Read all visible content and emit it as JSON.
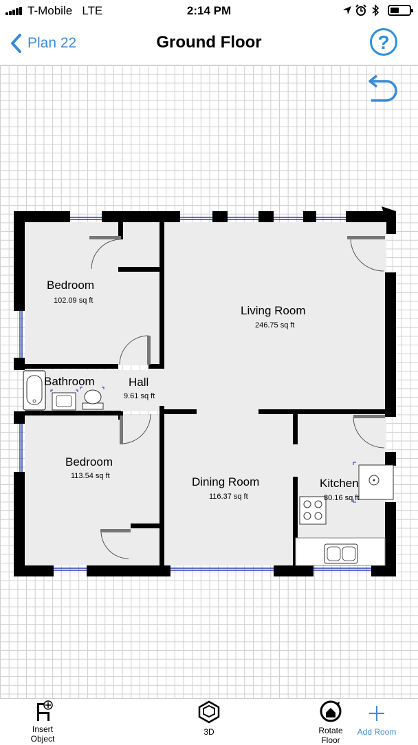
{
  "status_bar": {
    "carrier": "T-Mobile",
    "network": "LTE",
    "time": "2:14 PM"
  },
  "nav": {
    "back_label": "Plan 22",
    "title": "Ground Floor",
    "help_label": "?"
  },
  "rooms": [
    {
      "name": "Bedroom",
      "area": "102.09 sq ft"
    },
    {
      "name": "Living Room",
      "area": "246.75 sq ft"
    },
    {
      "name": "Bathroom",
      "area": ""
    },
    {
      "name": "Hall",
      "area": "9.61 sq ft"
    },
    {
      "name": "Bedroom",
      "area": "113.54 sq ft"
    },
    {
      "name": "Dining Room",
      "area": "116.37 sq ft"
    },
    {
      "name": "Kitchen",
      "area": "80.16 sq ft"
    }
  ],
  "toolbar": {
    "insert_object": "Insert\nObject",
    "three_d": "3D",
    "rotate_floor": "Rotate\nFloor",
    "add_room": "Add Room"
  },
  "colors": {
    "accent": "#3a8bd6",
    "wall": "#000000",
    "floor": "#ececec",
    "window": "#2a3fae"
  },
  "icons": [
    "back-chevron-icon",
    "help-icon",
    "undo-icon",
    "insert-object-icon",
    "3d-box-icon",
    "rotate-floor-icon",
    "add-room-icon"
  ]
}
